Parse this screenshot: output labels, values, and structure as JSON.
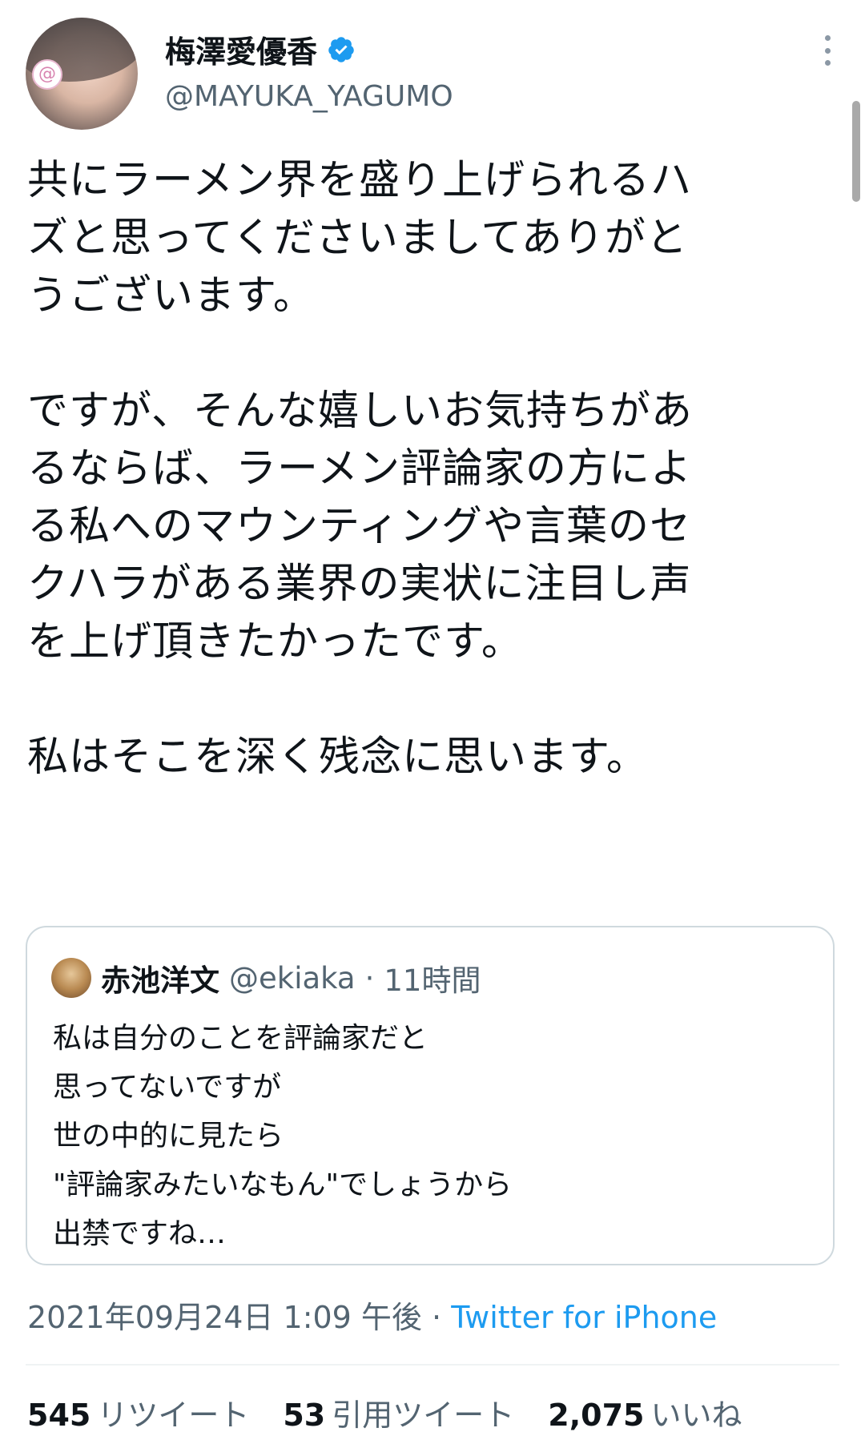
{
  "author": {
    "display_name": "梅澤愛優香",
    "handle": "@MAYUKA_YAGUMO",
    "verified": true
  },
  "tweet": {
    "paragraph1": "共にラーメン界を盛り上げられるハ\nズと思ってくださいましてありがと\nうございます。",
    "paragraph2": "ですが、そんな嬉しいお気持ちがあ\nるならば、ラーメン評論家の方によ\nる私へのマウンティングや言葉のセ\nクハラがある業界の実状に注目し声\nを上げ頂きたかったです。",
    "paragraph3": "私はそこを深く残念に思います。"
  },
  "quoted_tweet": {
    "name": "赤池洋文",
    "handle": "@ekiaka",
    "separator": "·",
    "time": "11時間",
    "text": "私は自分のことを評論家だと\n思ってないですが\n世の中的に見たら\n\"評論家みたいなもん\"でしょうから\n出禁ですね…"
  },
  "meta": {
    "date": "2021年09月24日",
    "time": "1:09 午後",
    "separator": "·",
    "source": "Twitter for iPhone"
  },
  "stats": {
    "retweets_count": "545",
    "retweets_label": "リツイート",
    "quotes_count": "53",
    "quotes_label": "引用ツイート",
    "likes_count": "2,075",
    "likes_label": "いいね"
  },
  "colors": {
    "link": "#1d9bf0",
    "secondary_text": "#536471",
    "border": "#cfd9de"
  }
}
